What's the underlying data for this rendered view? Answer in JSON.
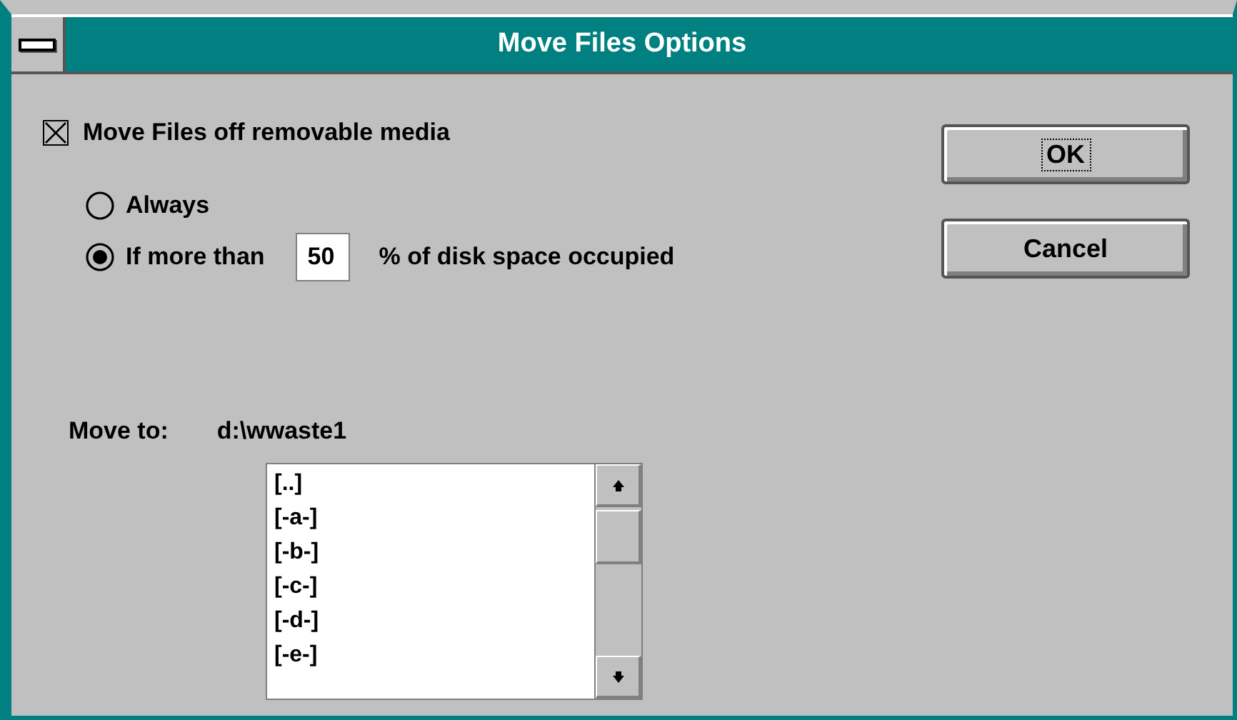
{
  "window": {
    "title": "Move Files Options"
  },
  "move_option": {
    "label": "Move Files off removable media",
    "checked": true
  },
  "radios": [
    {
      "label": "Always",
      "selected": false,
      "kind": "plain"
    },
    {
      "label": "If more than",
      "selected": true,
      "kind": "threshold",
      "value": "50",
      "suffix": "% of disk space occupied"
    }
  ],
  "move_to": {
    "label": "Move to:",
    "path": "d:\\wwaste1"
  },
  "directories": [
    "[..]",
    "[-a-]",
    "[-b-]",
    "[-c-]",
    "[-d-]",
    "[-e-]"
  ],
  "buttons": [
    {
      "label": "OK",
      "focused": true
    },
    {
      "label": "Cancel",
      "focused": false
    }
  ]
}
